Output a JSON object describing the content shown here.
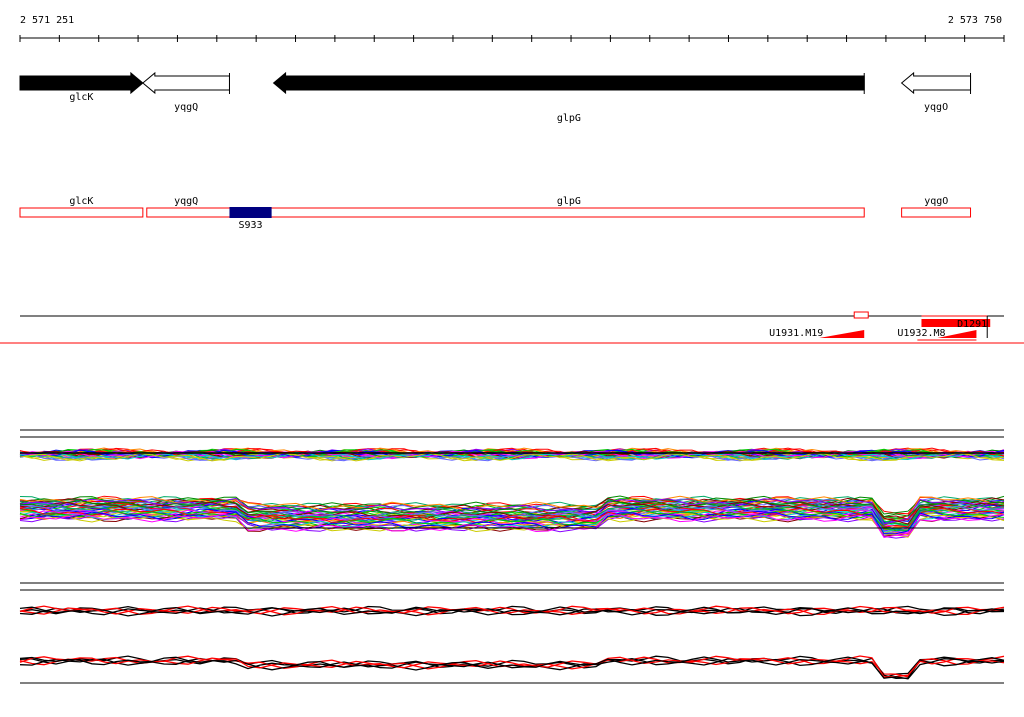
{
  "coords": {
    "start_label": "2 571 251",
    "end_label": "2 573 750",
    "start": 2571251,
    "end": 2573750
  },
  "genes": [
    {
      "name": "glcK",
      "start": 2571251,
      "end": 2571563,
      "strand": "+",
      "filled": true,
      "label_row": 0
    },
    {
      "name": "yqgQ",
      "start": 2571563,
      "end": 2571783,
      "strand": "-",
      "filled": false,
      "label_row": 1
    },
    {
      "name": "glpG",
      "start": 2571895,
      "end": 2573395,
      "strand": "-",
      "filled": true,
      "label_row": 2
    },
    {
      "name": "yqgO",
      "start": 2573490,
      "end": 2573665,
      "strand": "-",
      "filled": false,
      "label_row": 1
    }
  ],
  "annotations": [
    {
      "name": "glcK",
      "start": 2571251,
      "end": 2571563
    },
    {
      "name": "yqgQ",
      "start": 2571573,
      "end": 2573395
    },
    {
      "name": "yqgO",
      "start": 2573490,
      "end": 2573665
    }
  ],
  "annotation_labels": [
    {
      "text": "glcK",
      "pos": 2571407
    },
    {
      "text": "yqgQ",
      "pos": 2571673
    },
    {
      "text": "glpG",
      "pos": 2572645
    },
    {
      "text": "yqgO",
      "pos": 2573578
    }
  ],
  "features": [
    {
      "name": "S933",
      "start": 2571783,
      "end": 2571890,
      "color": "#000080"
    }
  ],
  "probes": [
    {
      "name": "U1931.M19",
      "start": 2573255,
      "end": 2573395,
      "color": "#ff0000"
    },
    {
      "name": "U1932.M8",
      "start": 2573530,
      "end": 2573680,
      "color": "#ff0000"
    },
    {
      "name": "D1291",
      "start": 2573515,
      "end": 2573715,
      "color": "#ff0000"
    }
  ],
  "colors": {
    "gene_outline": "#000000",
    "annotation": "#ff0000",
    "feature": "#000080",
    "probe": "#ff0000",
    "divider": "#ff0000"
  },
  "expression_palette": [
    "#ff0000",
    "#00cc00",
    "#0000ff",
    "#ff00ff",
    "#00cccc",
    "#cccc00",
    "#ff8800",
    "#8800ff",
    "#008800",
    "#880000",
    "#00aa66",
    "#6666ff"
  ]
}
